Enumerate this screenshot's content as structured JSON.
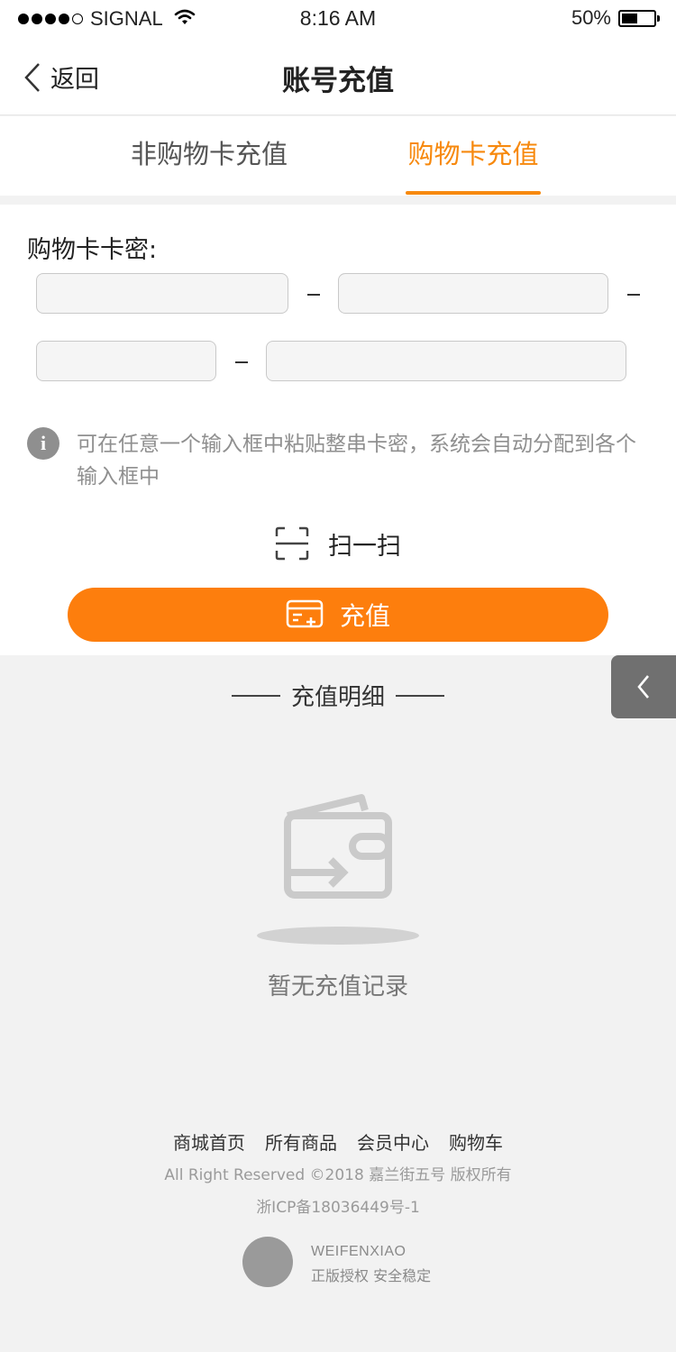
{
  "status_bar": {
    "carrier": "SIGNAL",
    "time": "8:16 AM",
    "battery_text": "50%",
    "battery_level": 0.5,
    "signal_bars": 4
  },
  "nav": {
    "back_label": "返回",
    "title": "账号充值"
  },
  "tabs": [
    {
      "label": "非购物卡充值",
      "active": false
    },
    {
      "label": "购物卡充值",
      "active": true
    }
  ],
  "form": {
    "label": "购物卡卡密:",
    "fields": [
      {
        "value": "",
        "placeholder": ""
      },
      {
        "value": "",
        "placeholder": ""
      },
      {
        "value": "",
        "placeholder": ""
      },
      {
        "value": "",
        "placeholder": ""
      }
    ],
    "hint_line1": "可在任意一个输入框中粘贴整串卡密，系统会自动分配到各个",
    "hint_line2": "输入框中",
    "scan_label": "扫一扫",
    "submit_label": "充值"
  },
  "details": {
    "title": "充值明细",
    "empty_text": "暂无充值记录"
  },
  "footer": {
    "links": [
      "商城首页",
      "所有商品",
      "会员中心",
      "购物车"
    ],
    "copyright": "All Right Reserved ©2018 嘉兰街五号 版权所有",
    "icp": "浙ICP备18036449号-1",
    "brand_name": "WEIFENXIAO",
    "brand_tagline": "正版授权  安全稳定"
  },
  "colors": {
    "accent": "#f7890e",
    "button": "#fd7e0d",
    "side_tab": "#707070"
  },
  "icons": [
    "wifi-icon",
    "battery-icon",
    "back-chevron-icon",
    "info-icon",
    "scan-icon",
    "card-add-icon",
    "chevron-left-icon",
    "wallet-icon"
  ]
}
